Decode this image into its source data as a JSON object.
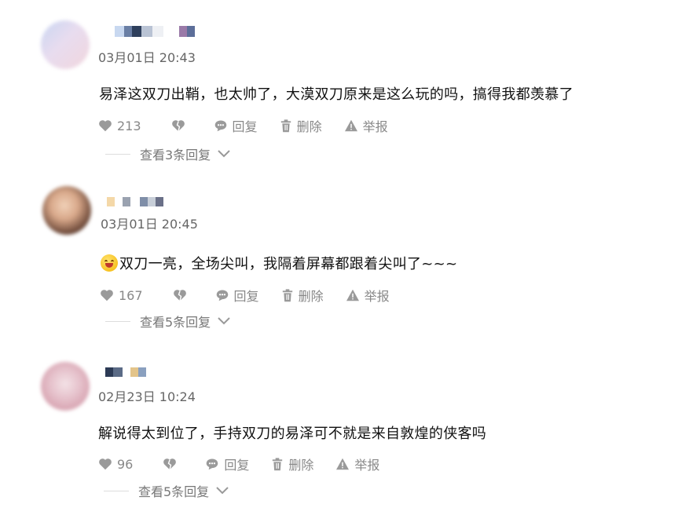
{
  "comments": [
    {
      "time": "03月01日 20:43",
      "text": "易泽这双刀出鞘，也太帅了，大漠双刀原来是这么玩的吗，搞得我都羡慕了",
      "likes": "213",
      "reply_label": "回复",
      "delete_label": "删除",
      "report_label": "举报",
      "view_replies": "查看3条回复",
      "has_emoji": false
    },
    {
      "time": "03月01日 20:45",
      "text": "双刀一亮，全场尖叫，我隔着屏幕都跟着尖叫了~~~",
      "likes": "167",
      "reply_label": "回复",
      "delete_label": "删除",
      "report_label": "举报",
      "view_replies": "查看5条回复",
      "has_emoji": true
    },
    {
      "time": "02月23日 10:24",
      "text": "解说得太到位了，手持双刀的易泽可不就是来自敦煌的侠客吗",
      "likes": "96",
      "reply_label": "回复",
      "delete_label": "删除",
      "report_label": "举报",
      "view_replies": "查看5条回复",
      "has_emoji": false
    }
  ],
  "icons": {
    "like": "heart-icon",
    "dislike": "thumbs-down-heart-icon",
    "reply": "chat-bubble-icon",
    "delete": "trash-icon",
    "report": "warning-triangle-icon",
    "expand": "chevron-down-icon"
  },
  "colors": {
    "text": "#111111",
    "meta": "#888888",
    "time": "#666666"
  }
}
